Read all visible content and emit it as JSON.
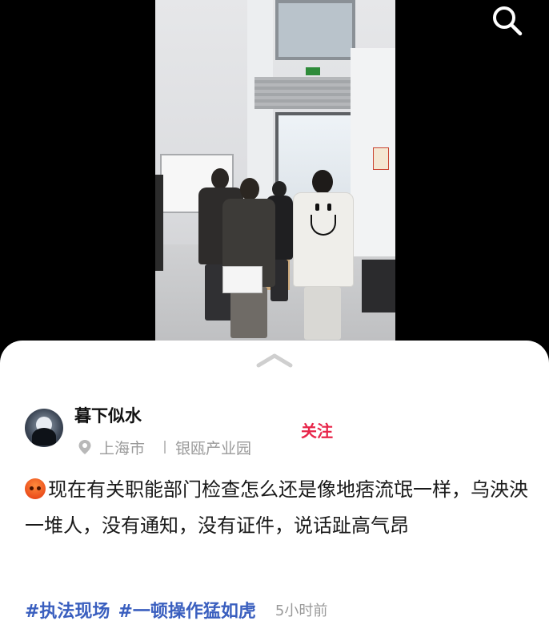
{
  "video": {
    "search_icon": "search-icon"
  },
  "post": {
    "author": {
      "name": "暮下似水",
      "avatar_icon": "avatar-moon-tree"
    },
    "location": {
      "icon": "location-pin-icon",
      "city": "上海市",
      "place": "银瓯产业园"
    },
    "follow_label": "关注",
    "emoji": "angry-face-icon",
    "text": "现在有关职能部门检查怎么还是像地痞流氓一样，乌泱泱一堆人，没有通知，没有证件，说话趾高气昂",
    "tags": [
      "#执法现场",
      "#一顿操作猛如虎"
    ],
    "time_ago": "5小时前"
  },
  "colors": {
    "follow": "#e8264a",
    "tag": "#3a5fbf",
    "muted": "#9a9a9a"
  }
}
